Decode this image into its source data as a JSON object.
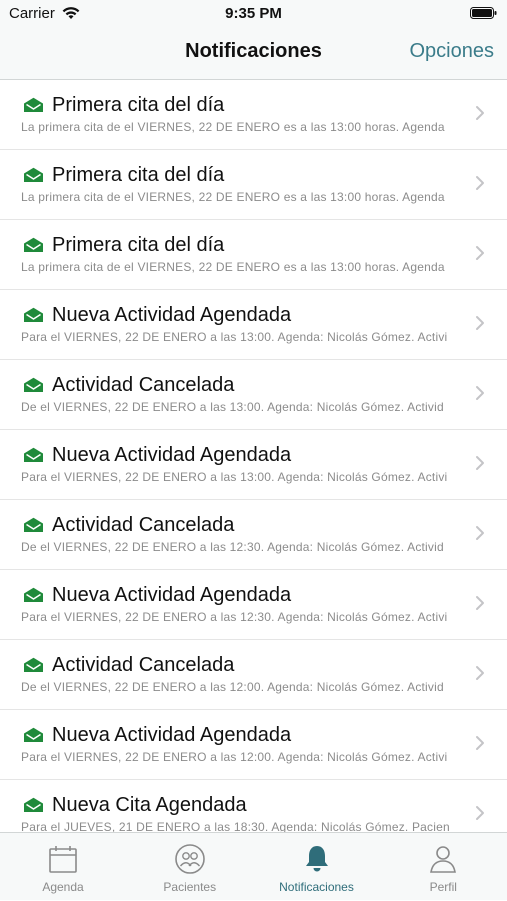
{
  "status_bar": {
    "carrier": "Carrier",
    "time": "9:35 PM"
  },
  "nav": {
    "title": "Notificaciones",
    "action": "Opciones"
  },
  "notifications": [
    {
      "title": "Primera cita del día",
      "preview": "La primera cita de el VIERNES, 22 DE ENERO es a las 13:00 horas. Agenda"
    },
    {
      "title": "Primera cita del día",
      "preview": "La primera cita de el VIERNES, 22 DE ENERO es a las 13:00 horas. Agenda"
    },
    {
      "title": "Primera cita del día",
      "preview": "La primera cita de el VIERNES, 22 DE ENERO es a las 13:00 horas. Agenda"
    },
    {
      "title": "Nueva Actividad Agendada",
      "preview": "Para el VIERNES, 22 DE ENERO a las 13:00. Agenda: Nicolás Gómez. Activi"
    },
    {
      "title": "Actividad Cancelada",
      "preview": "De el VIERNES, 22 DE ENERO a las 13:00. Agenda: Nicolás Gómez. Activid"
    },
    {
      "title": "Nueva Actividad Agendada",
      "preview": "Para el VIERNES, 22 DE ENERO a las 13:00. Agenda: Nicolás Gómez. Activi"
    },
    {
      "title": "Actividad Cancelada",
      "preview": "De el VIERNES, 22 DE ENERO a las 12:30. Agenda: Nicolás Gómez. Activid"
    },
    {
      "title": "Nueva Actividad Agendada",
      "preview": "Para el VIERNES, 22 DE ENERO a las 12:30. Agenda: Nicolás Gómez. Activi"
    },
    {
      "title": "Actividad Cancelada",
      "preview": "De el VIERNES, 22 DE ENERO a las 12:00. Agenda: Nicolás Gómez. Activid"
    },
    {
      "title": "Nueva Actividad Agendada",
      "preview": "Para el VIERNES, 22 DE ENERO a las 12:00. Agenda: Nicolás Gómez. Activi"
    },
    {
      "title": "Nueva Cita Agendada",
      "preview": "Para el JUEVES, 21 DE ENERO a las 18:30. Agenda: Nicolás Gómez. Pacien"
    }
  ],
  "tabs": [
    {
      "label": "Agenda",
      "icon": "calendar-icon",
      "active": false
    },
    {
      "label": "Pacientes",
      "icon": "patients-icon",
      "active": false
    },
    {
      "label": "Notificaciones",
      "icon": "bell-icon",
      "active": true
    },
    {
      "label": "Perfil",
      "icon": "person-icon",
      "active": false
    }
  ],
  "colors": {
    "accent": "#3b7c8a",
    "active_tab": "#2f6d7a",
    "envelope_green": "#1f8a3a",
    "bar_background": "#f7f9f9"
  }
}
